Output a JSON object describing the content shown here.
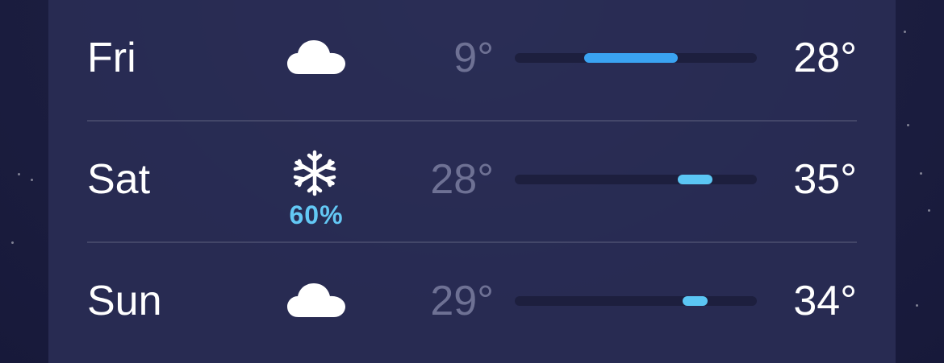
{
  "forecast": {
    "scale": {
      "min": -5,
      "max": 44
    },
    "days": [
      {
        "day": "Fri",
        "condition": "cloud-icon",
        "precip": "",
        "low_label": "9°",
        "high_label": "28°",
        "low": 9,
        "high": 28,
        "bar_color": "#3aa3f2"
      },
      {
        "day": "Sat",
        "condition": "snowflake-icon",
        "precip": "60%",
        "low_label": "28°",
        "high_label": "35°",
        "low": 28,
        "high": 35,
        "bar_color": "#5bc6f4"
      },
      {
        "day": "Sun",
        "condition": "cloud-icon",
        "precip": "",
        "low_label": "29°",
        "high_label": "34°",
        "low": 29,
        "high": 34,
        "bar_color": "#5bc6f4"
      }
    ]
  },
  "colors": {
    "precip": "#63c8f5",
    "low_text": "#6e7194",
    "high_text": "#ffffff"
  }
}
